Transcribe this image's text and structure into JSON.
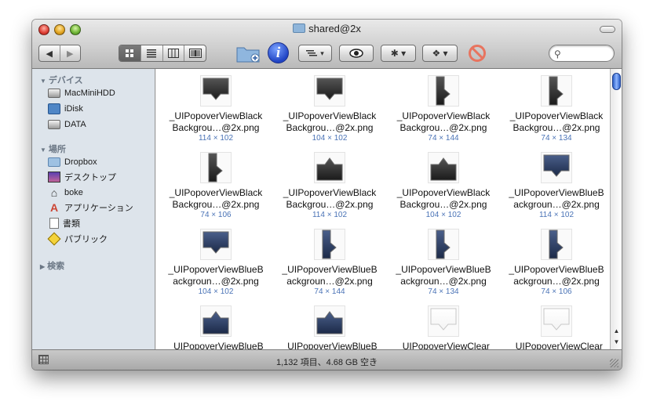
{
  "window": {
    "title": "shared@2x"
  },
  "toolbar": {
    "back_icon": "◀",
    "forward_icon": "▶",
    "view_icons": [
      "icon-view",
      "list-view",
      "column-view",
      "coverflow-view"
    ],
    "arrange_label": "▾",
    "quicklook_label": "👁",
    "action_label": "✱ ▾",
    "dropbox_label": "❖ ▾",
    "search_placeholder": ""
  },
  "sidebar": {
    "devices_header": "デバイス",
    "devices": [
      {
        "label": "MacMiniHDD",
        "icon": "hdd-icon"
      },
      {
        "label": "iDisk",
        "icon": "idisk-icon"
      },
      {
        "label": "DATA",
        "icon": "hdd-icon"
      }
    ],
    "places_header": "場所",
    "places": [
      {
        "label": "Dropbox",
        "icon": "folder-icon"
      },
      {
        "label": "デスクトップ",
        "icon": "desktop-icon"
      },
      {
        "label": "boke",
        "icon": "home-icon"
      },
      {
        "label": "アプリケーション",
        "icon": "applications-icon"
      },
      {
        "label": "書類",
        "icon": "documents-icon"
      },
      {
        "label": "パブリック",
        "icon": "public-icon"
      }
    ],
    "search_header": "検索"
  },
  "files": [
    {
      "line1": "_UIPopoverViewBlack",
      "line2": "Backgrou…@2x.png",
      "dims": "114 × 102",
      "thumb": "black-down"
    },
    {
      "line1": "_UIPopoverViewBlack",
      "line2": "Backgrou…@2x.png",
      "dims": "104 × 102",
      "thumb": "black-down"
    },
    {
      "line1": "_UIPopoverViewBlack",
      "line2": "Backgrou…@2x.png",
      "dims": "74 × 144",
      "thumb": "black-right"
    },
    {
      "line1": "_UIPopoverViewBlack",
      "line2": "Backgrou…@2x.png",
      "dims": "74 × 134",
      "thumb": "black-right"
    },
    {
      "line1": "_UIPopoverViewBlack",
      "line2": "Backgrou…@2x.png",
      "dims": "74 × 106",
      "thumb": "black-right"
    },
    {
      "line1": "_UIPopoverViewBlack",
      "line2": "Backgrou…@2x.png",
      "dims": "114 × 102",
      "thumb": "black-up"
    },
    {
      "line1": "_UIPopoverViewBlack",
      "line2": "Backgrou…@2x.png",
      "dims": "104 × 102",
      "thumb": "black-up"
    },
    {
      "line1": "_UIPopoverViewBlueB",
      "line2": "ackgroun…@2x.png",
      "dims": "114 × 102",
      "thumb": "blue-down"
    },
    {
      "line1": "_UIPopoverViewBlueB",
      "line2": "ackgroun…@2x.png",
      "dims": "104 × 102",
      "thumb": "blue-down"
    },
    {
      "line1": "_UIPopoverViewBlueB",
      "line2": "ackgroun…@2x.png",
      "dims": "74 × 144",
      "thumb": "blue-right"
    },
    {
      "line1": "_UIPopoverViewBlueB",
      "line2": "ackgroun…@2x.png",
      "dims": "74 × 134",
      "thumb": "blue-right"
    },
    {
      "line1": "_UIPopoverViewBlueB",
      "line2": "ackgroun…@2x.png",
      "dims": "74 × 106",
      "thumb": "blue-right"
    },
    {
      "line1": "_UIPopoverViewBlueB",
      "line2": "",
      "dims": "",
      "thumb": "blue-up"
    },
    {
      "line1": "_UIPopoverViewBlueB",
      "line2": "",
      "dims": "",
      "thumb": "blue-up"
    },
    {
      "line1": "_UIPopoverViewClear",
      "line2": "",
      "dims": "",
      "thumb": "clear-down"
    },
    {
      "line1": "_UIPopoverViewClear",
      "line2": "",
      "dims": "",
      "thumb": "clear-down"
    }
  ],
  "status": {
    "text": "1,132 項目、4.68 GB 空き"
  },
  "colors": {
    "sidebar_bg": "#dde4eb",
    "dims_text": "#4a73b6",
    "selection_blue": "#2c5fc7"
  }
}
